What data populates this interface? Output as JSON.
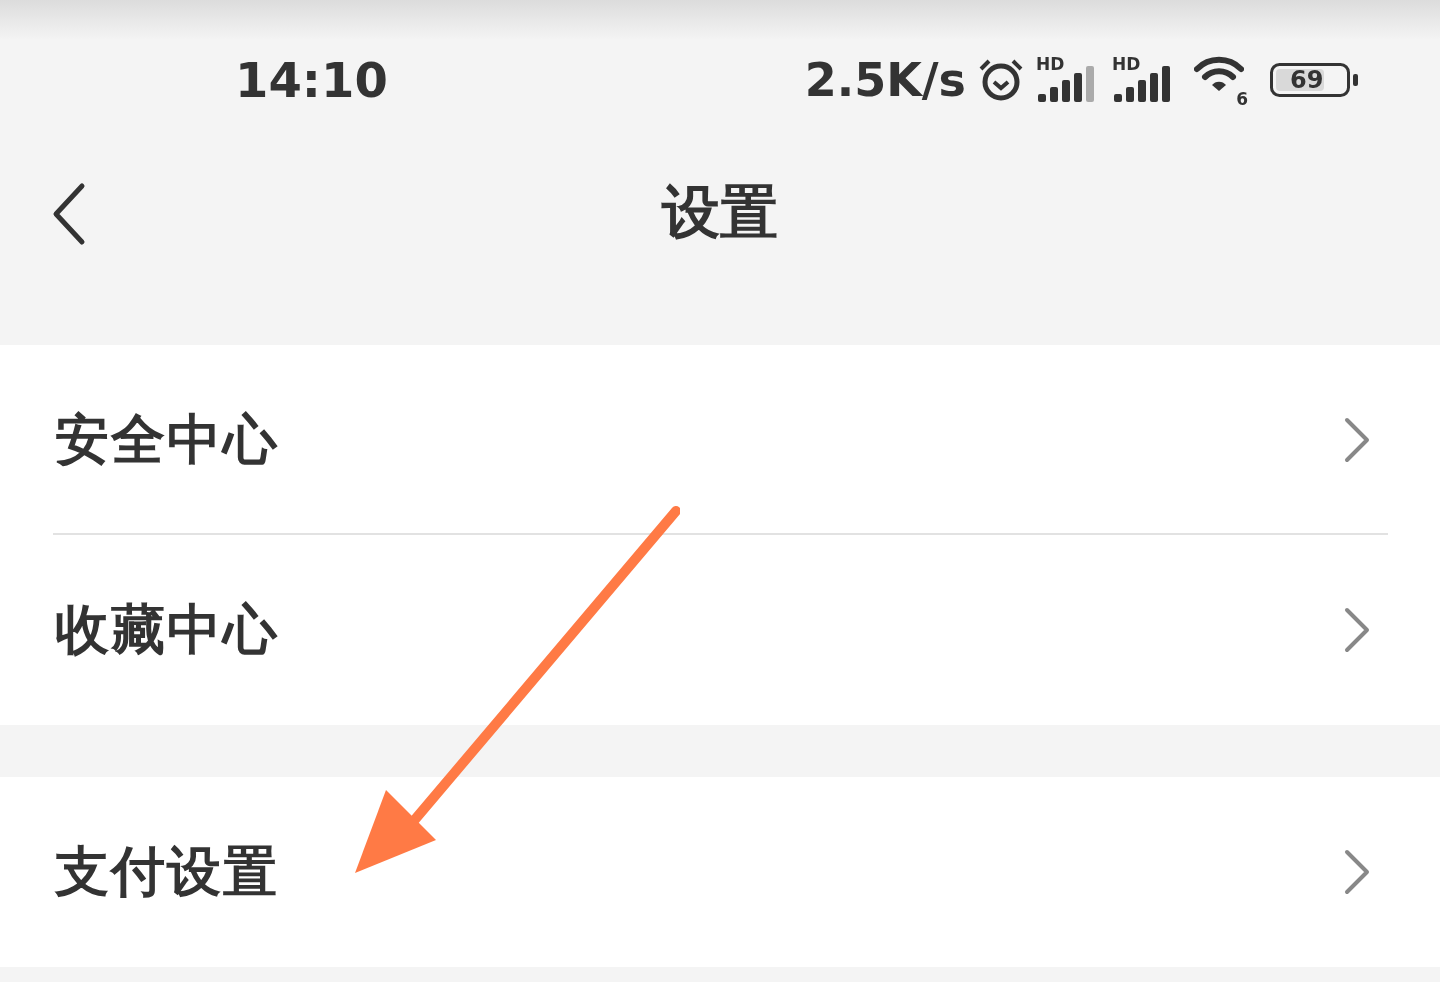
{
  "status_bar": {
    "time": "14:10",
    "speed": "2.5K/s",
    "sim_labels": [
      "HD",
      "HD"
    ],
    "wifi_label": "6",
    "battery": "69"
  },
  "header": {
    "title": "设置"
  },
  "groups": [
    {
      "items": [
        {
          "label": "安全中心"
        },
        {
          "label": "收藏中心"
        }
      ]
    },
    {
      "items": [
        {
          "label": "支付设置"
        }
      ]
    }
  ]
}
